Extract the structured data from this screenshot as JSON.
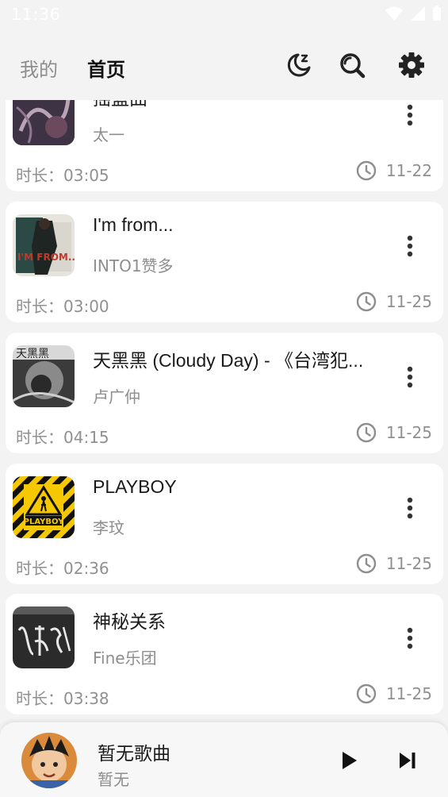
{
  "status_bar": {
    "time": "11:36"
  },
  "header": {
    "tabs": [
      {
        "label": "我的",
        "active": false
      },
      {
        "label": "首页",
        "active": true
      }
    ],
    "icons": [
      "night-mode-icon",
      "search-icon",
      "settings-icon"
    ]
  },
  "songs": [
    {
      "title": "摇篮曲",
      "artist": "太一",
      "duration_label": "时长：",
      "duration": "03:05",
      "date": "11-22"
    },
    {
      "title": "I'm from...",
      "artist": "INTO1赞多",
      "duration_label": "时长：",
      "duration": "03:00",
      "date": "11-25"
    },
    {
      "title": "天黑黑 (Cloudy Day) - 《台湾犯...",
      "artist": "卢广仲",
      "duration_label": "时长：",
      "duration": "04:15",
      "date": "11-25"
    },
    {
      "title": "PLAYBOY",
      "artist": "李玟",
      "duration_label": "时长：",
      "duration": "02:36",
      "date": "11-25"
    },
    {
      "title": "神秘关系",
      "artist": "Fine乐团",
      "duration_label": "时长：",
      "duration": "03:38",
      "date": "11-25"
    }
  ],
  "covers": {
    "playboy_text": "PLAYBOY",
    "tianheihei_text": "天黑黑",
    "imfrom_text": "I'M FROM..."
  },
  "player": {
    "title": "暂无歌曲",
    "subtitle": "暂无"
  },
  "colors": {
    "background": "#f3f3f3",
    "card": "#ffffff",
    "text_primary": "#1a1a1a",
    "text_secondary": "#8e8e8e",
    "icon": "#222222"
  }
}
